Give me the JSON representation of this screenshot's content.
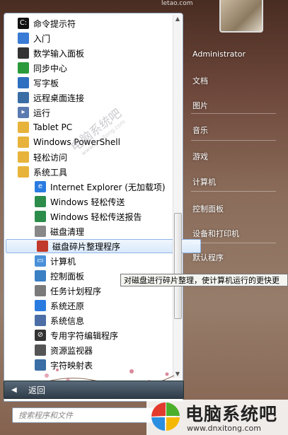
{
  "site_tag": "letao.com",
  "program_list": [
    {
      "label": "命令提示符",
      "icon": "cmd-icon",
      "level": 0
    },
    {
      "label": "入门",
      "icon": "getting-started-icon",
      "level": 0
    },
    {
      "label": "数学输入面板",
      "icon": "math-input-icon",
      "level": 0
    },
    {
      "label": "同步中心",
      "icon": "sync-center-icon",
      "level": 0
    },
    {
      "label": "写字板",
      "icon": "wordpad-icon",
      "level": 0
    },
    {
      "label": "远程桌面连接",
      "icon": "remote-desktop-icon",
      "level": 0
    },
    {
      "label": "运行",
      "icon": "run-icon",
      "level": 0
    },
    {
      "label": "Tablet PC",
      "icon": "folder-icon",
      "level": 0
    },
    {
      "label": "Windows PowerShell",
      "icon": "folder-icon",
      "level": 0
    },
    {
      "label": "轻松访问",
      "icon": "folder-icon",
      "level": 0
    },
    {
      "label": "系统工具",
      "icon": "folder-icon",
      "level": 0
    },
    {
      "label": "Internet Explorer (无加载项)",
      "icon": "ie-icon",
      "level": 1
    },
    {
      "label": "Windows 轻松传送",
      "icon": "easy-transfer-icon",
      "level": 1
    },
    {
      "label": "Windows 轻松传送报告",
      "icon": "easy-transfer-report-icon",
      "level": 1
    },
    {
      "label": "磁盘清理",
      "icon": "disk-cleanup-icon",
      "level": 1
    },
    {
      "label": "磁盘碎片整理程序",
      "icon": "defrag-icon",
      "level": 1,
      "selected": true
    },
    {
      "label": "计算机",
      "icon": "computer-icon",
      "level": 1
    },
    {
      "label": "控制面板",
      "icon": "control-panel-icon",
      "level": 1
    },
    {
      "label": "任务计划程序",
      "icon": "task-scheduler-icon",
      "level": 1
    },
    {
      "label": "系统还原",
      "icon": "system-restore-icon",
      "level": 1
    },
    {
      "label": "系统信息",
      "icon": "system-info-icon",
      "level": 1
    },
    {
      "label": "专用字符编辑程序",
      "icon": "char-editor-icon",
      "level": 1
    },
    {
      "label": "资源监视器",
      "icon": "resource-monitor-icon",
      "level": 1
    },
    {
      "label": "字符映射表",
      "icon": "char-map-icon",
      "level": 1
    }
  ],
  "back_label": "返回",
  "search_placeholder": "搜索程序和文件",
  "right_links": [
    "Administrator",
    "文档",
    "图片",
    "音乐",
    "游戏",
    "计算机",
    "控制面板",
    "设备和打印机",
    "默认程序"
  ],
  "tooltip": "对磁盘进行碎片整理，使计算机运行的更快更",
  "watermark_center": "电脑系统吧",
  "watermark_center_url": "www.dnxitong.com",
  "logo_title": "电脑系统吧",
  "logo_url": "www.dnxitong.com",
  "colors": {
    "selection": "#d9e9fb",
    "folder": "#e8b33a",
    "back_bar": "#2f3b48"
  }
}
